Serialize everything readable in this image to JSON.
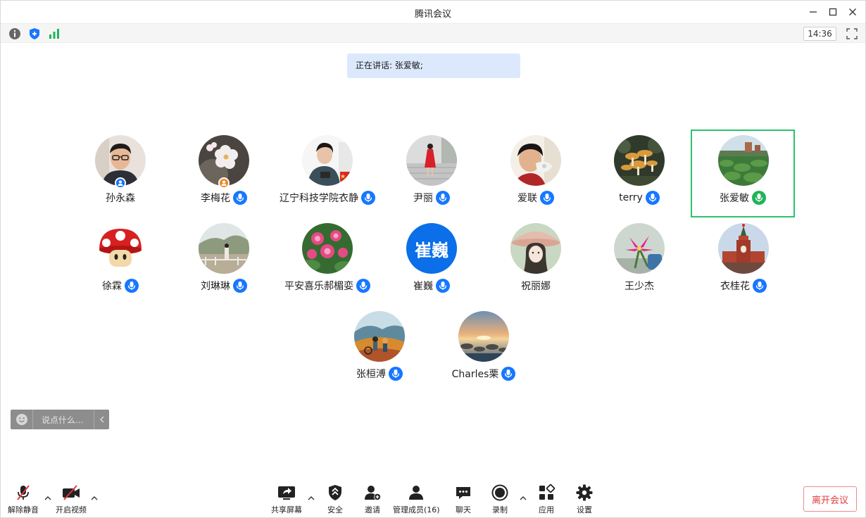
{
  "window": {
    "title": "腾讯会议",
    "clock": "14:36"
  },
  "banner": {
    "speaking_text": "正在讲话: 张爱敏;"
  },
  "colors": {
    "accent_blue": "#1677ff",
    "active_green": "#2cc36b",
    "signal_green": "#21b35b",
    "leave_red": "#e23b3b"
  },
  "participants": [
    {
      "name": "孙永森",
      "mic": "none",
      "badge": "host-blue",
      "avatar": "person-glasses"
    },
    {
      "name": "李梅花",
      "mic": "blue",
      "badge": "cohost-orange",
      "avatar": "blossom"
    },
    {
      "name": "辽宁科技学院衣静",
      "mic": "blue",
      "badge": "none",
      "avatar": "woman-phone"
    },
    {
      "name": "尹丽",
      "mic": "blue",
      "badge": "none",
      "avatar": "red-dress"
    },
    {
      "name": "爱联",
      "mic": "blue",
      "badge": "none",
      "avatar": "child"
    },
    {
      "name": "terry",
      "mic": "blue",
      "badge": "none",
      "avatar": "mushrooms"
    },
    {
      "name": "张爱敏",
      "mic": "green",
      "badge": "none",
      "avatar": "lotus-pond",
      "active": true
    },
    {
      "name": "徐霖",
      "mic": "blue",
      "badge": "none",
      "avatar": "red-mushroom"
    },
    {
      "name": "刘琳琳",
      "mic": "blue",
      "badge": "none",
      "avatar": "park"
    },
    {
      "name": "平安喜乐郝楣娈",
      "mic": "blue",
      "badge": "none",
      "avatar": "flowers"
    },
    {
      "name": "崔巍",
      "mic": "blue",
      "badge": "none",
      "avatar": "initials",
      "initials": "崔巍"
    },
    {
      "name": "祝丽娜",
      "mic": "none",
      "badge": "none",
      "avatar": "girl-hat"
    },
    {
      "name": "王少杰",
      "mic": "none",
      "badge": "none",
      "avatar": "pink-flower"
    },
    {
      "name": "衣桂花",
      "mic": "blue",
      "badge": "none",
      "avatar": "kremlin"
    },
    {
      "name": "张桓溥",
      "mic": "blue",
      "badge": "none",
      "avatar": "painting"
    },
    {
      "name": "Charles栗",
      "mic": "blue",
      "badge": "none",
      "avatar": "sunset-sea"
    }
  ],
  "chat": {
    "placeholder": "说点什么..."
  },
  "toolbar": {
    "unmute": "解除静音",
    "start_video": "开启视频",
    "share_screen": "共享屏幕",
    "security": "安全",
    "invite": "邀请",
    "manage_members": "管理成员(16)",
    "chat": "聊天",
    "record": "录制",
    "apps": "应用",
    "settings": "设置",
    "leave": "离开会议"
  }
}
